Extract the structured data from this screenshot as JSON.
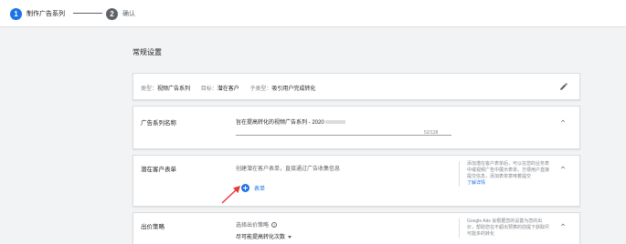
{
  "stepper": {
    "steps": [
      {
        "number": "1",
        "label": "制作广告系列"
      },
      {
        "number": "2",
        "label": "确认"
      }
    ]
  },
  "section": {
    "title": "常规设置"
  },
  "summary": {
    "type_label": "类型：",
    "type_value": "视频广告系列",
    "goal_label": "目标：",
    "goal_value": "潜在客户",
    "subtype_label": "子类型：",
    "subtype_value": "吸引用户完成转化"
  },
  "campaign_name": {
    "label": "广告系列名称",
    "value": "旨在提高转化的视频广告系列 - 2020",
    "counter": "52/128"
  },
  "lead_form": {
    "label": "潜在客户表单",
    "description": "创建潜在客户表单，直接通过广告收集信息",
    "add_label": "表单",
    "help_text": "添加潜在客户表单后，可以在您的业务表中或视频广告中展示表单，方便用户直接提交信息，添加表单意味着提交",
    "help_link": "了解详情"
  },
  "bidding": {
    "label": "出价策略",
    "prompt": "选择出价策略",
    "selected": "尽可能提高转化次数",
    "help_text": "Google Ads 会根据您的设置为您的出价，帮助您在不超出预算的前提下获取尽可能多的转化"
  },
  "colors": {
    "accent": "#1a73e8",
    "arrow": "#e53935"
  },
  "icons": {
    "edit": "edit-pencil-icon",
    "expand": "chevron-up-icon",
    "info": "help-circle-icon",
    "add": "add-circle-icon"
  }
}
